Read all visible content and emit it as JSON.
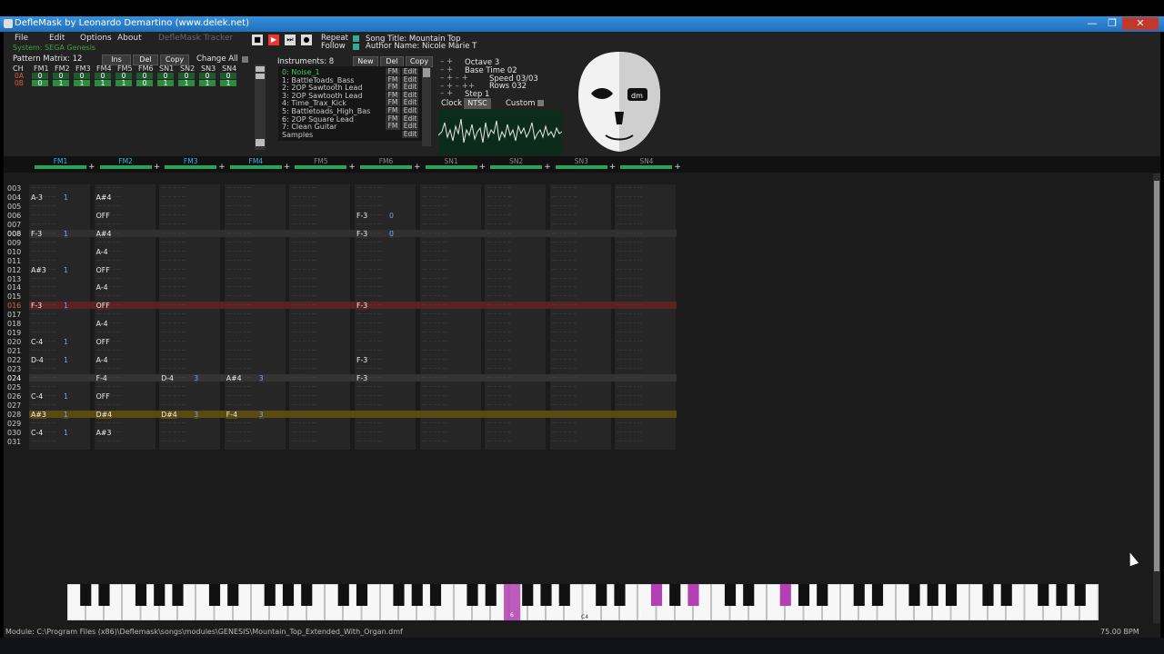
{
  "window": {
    "title": "DefleMask by Leonardo Demartino (www.delek.net)",
    "buttons": [
      "—",
      "❐",
      "✕"
    ]
  },
  "menu": [
    "File",
    "Edit",
    "Options",
    "About",
    "DefleMask Tracker"
  ],
  "system": "System: SEGA Genesis",
  "transport": {
    "stop": "■",
    "play": "▶",
    "step": "⏭",
    "record": "●"
  },
  "flags": {
    "repeat": "Repeat",
    "follow": "Follow"
  },
  "song": {
    "title": "Song Title: Mountain Top",
    "author": "Author Name: Nicole Marie T"
  },
  "pattern_matrix": {
    "label": "Pattern Matrix: 12",
    "ins": "Ins",
    "del": "Del",
    "copy": "Copy",
    "change_all": "Change All",
    "columns": [
      "CH",
      "FM1",
      "FM2",
      "FM3",
      "FM4",
      "FM5",
      "FM6",
      "SN1",
      "SN2",
      "SN3",
      "SN4"
    ],
    "rows": [
      [
        "0A",
        "0",
        "0",
        "0",
        "0",
        "0",
        "0",
        "0",
        "0",
        "0",
        "0"
      ],
      [
        "0B",
        "0",
        "1",
        "1",
        "1",
        "1",
        "0",
        "1",
        "1",
        "1",
        "1"
      ]
    ]
  },
  "instruments": {
    "label": "Instruments: 8",
    "new": "New",
    "del": "Del",
    "copy": "Copy",
    "list": [
      "0: Noise_1",
      "1: BattleToads_Bass",
      "2: 2OP Sawtooth Lead",
      "3: 2OP Sawtooth Lead",
      "4: Time_Trax_Kick",
      "5: Battletoads_High_Bas",
      "6: 2OP Square Lead",
      "7: Clean Guitar",
      "Samples"
    ],
    "type": "FM",
    "edit": "Edit"
  },
  "settings": {
    "octave": "Octave 3",
    "base_time": "Base Time 02",
    "speed": "Speed 03/03",
    "rows": "Rows 032",
    "step": "Step 1",
    "clock": "Clock",
    "clock_value": "NTSC",
    "custom": "Custom"
  },
  "channels": [
    "FM1",
    "FM2",
    "FM3",
    "FM4",
    "FM5",
    "FM6",
    "SN1",
    "SN2",
    "SN3",
    "SN4"
  ],
  "row_numbers": [
    "003",
    "004",
    "005",
    "006",
    "007",
    "008",
    "009",
    "010",
    "011",
    "012",
    "013",
    "014",
    "015",
    "016",
    "017",
    "018",
    "019",
    "020",
    "021",
    "022",
    "023",
    "024",
    "025",
    "026",
    "027",
    "028",
    "029",
    "030",
    "031"
  ],
  "pattern_notes": [
    {
      "row": 1,
      "ch": 0,
      "note": "A-3",
      "ins": "1"
    },
    {
      "row": 1,
      "ch": 1,
      "note": "A#4",
      "ins": ""
    },
    {
      "row": 3,
      "ch": 1,
      "note": "OFF",
      "ins": ""
    },
    {
      "row": 3,
      "ch": 5,
      "note": "F-3",
      "ins": "0"
    },
    {
      "row": 5,
      "ch": 0,
      "note": "F-3",
      "ins": "1"
    },
    {
      "row": 5,
      "ch": 1,
      "note": "A#4",
      "ins": ""
    },
    {
      "row": 5,
      "ch": 5,
      "note": "F-3",
      "ins": "0"
    },
    {
      "row": 7,
      "ch": 1,
      "note": "A-4",
      "ins": ""
    },
    {
      "row": 9,
      "ch": 0,
      "note": "A#3",
      "ins": "1"
    },
    {
      "row": 9,
      "ch": 1,
      "note": "OFF",
      "ins": ""
    },
    {
      "row": 11,
      "ch": 1,
      "note": "A-4",
      "ins": ""
    },
    {
      "row": 13,
      "ch": 0,
      "note": "F-3",
      "ins": "1"
    },
    {
      "row": 13,
      "ch": 1,
      "note": "OFF",
      "ins": ""
    },
    {
      "row": 13,
      "ch": 5,
      "note": "F-3",
      "ins": ""
    },
    {
      "row": 15,
      "ch": 1,
      "note": "A-4",
      "ins": ""
    },
    {
      "row": 17,
      "ch": 0,
      "note": "C-4",
      "ins": "1"
    },
    {
      "row": 17,
      "ch": 1,
      "note": "OFF",
      "ins": ""
    },
    {
      "row": 19,
      "ch": 0,
      "note": "D-4",
      "ins": "1"
    },
    {
      "row": 19,
      "ch": 1,
      "note": "A-4",
      "ins": ""
    },
    {
      "row": 19,
      "ch": 5,
      "note": "F-3",
      "ins": ""
    },
    {
      "row": 21,
      "ch": 1,
      "note": "F-4",
      "ins": ""
    },
    {
      "row": 21,
      "ch": 2,
      "note": "D-4",
      "ins": "3"
    },
    {
      "row": 21,
      "ch": 3,
      "note": "A#4",
      "ins": "3"
    },
    {
      "row": 21,
      "ch": 5,
      "note": "F-3",
      "ins": ""
    },
    {
      "row": 23,
      "ch": 0,
      "note": "C-4",
      "ins": "1"
    },
    {
      "row": 23,
      "ch": 1,
      "note": "OFF",
      "ins": ""
    },
    {
      "row": 25,
      "ch": 0,
      "note": "A#3",
      "ins": "1"
    },
    {
      "row": 25,
      "ch": 1,
      "note": "D#4",
      "ins": ""
    },
    {
      "row": 25,
      "ch": 2,
      "note": "D#4",
      "ins": "3"
    },
    {
      "row": 25,
      "ch": 3,
      "note": "F-4",
      "ins": "3"
    },
    {
      "row": 27,
      "ch": 0,
      "note": "C-4",
      "ins": "1"
    },
    {
      "row": 27,
      "ch": 1,
      "note": "A#3",
      "ins": ""
    }
  ],
  "piano_labels": [
    "6",
    "1",
    "3",
    "4",
    "C4"
  ],
  "status": {
    "module": "Module: C:\\Program Files (x86)\\Deflemask\\songs\\modules\\GENESIS\\Mountain_Top_Extended_With_Organ.dmf",
    "bpm": "75.00 BPM"
  },
  "colors": {
    "accent_green": "#29a35a",
    "highlight_red": "#5a2222",
    "highlight_orange": "#5a4a10",
    "piano_active": "#b340b3",
    "channel_active": "#36b6e6"
  }
}
